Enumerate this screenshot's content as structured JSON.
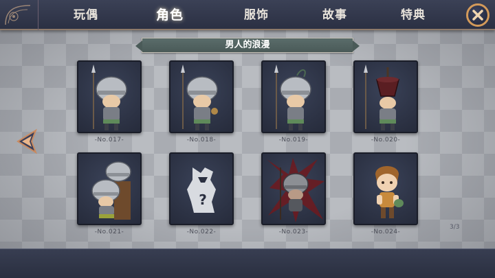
{
  "tabs": [
    {
      "label": "玩偶"
    },
    {
      "label": "角色"
    },
    {
      "label": "服饰"
    },
    {
      "label": "故事"
    },
    {
      "label": "特典"
    }
  ],
  "active_tab": "角色",
  "banner": {
    "title": "男人的浪漫"
  },
  "cards": [
    {
      "label": "-No.017-",
      "icon": "spear-soldier"
    },
    {
      "label": "-No.018-",
      "icon": "spear-soldier"
    },
    {
      "label": "-No.019-",
      "icon": "spear-soldier-plumed"
    },
    {
      "label": "-No.020-",
      "icon": "soldier-tall-hat"
    },
    {
      "label": "-No.021-",
      "icon": "stacked-soldiers"
    },
    {
      "label": "-No.022-",
      "icon": "locked-mystery"
    },
    {
      "label": "-No.023-",
      "icon": "cursed-soldier"
    },
    {
      "label": "-No.024-",
      "icon": "boy-character"
    }
  ],
  "page_indicator": "3/3",
  "colors": {
    "topbar": "#2f3447",
    "accent": "#d39a5a",
    "banner": "#52625f",
    "card": "#2e3447"
  }
}
